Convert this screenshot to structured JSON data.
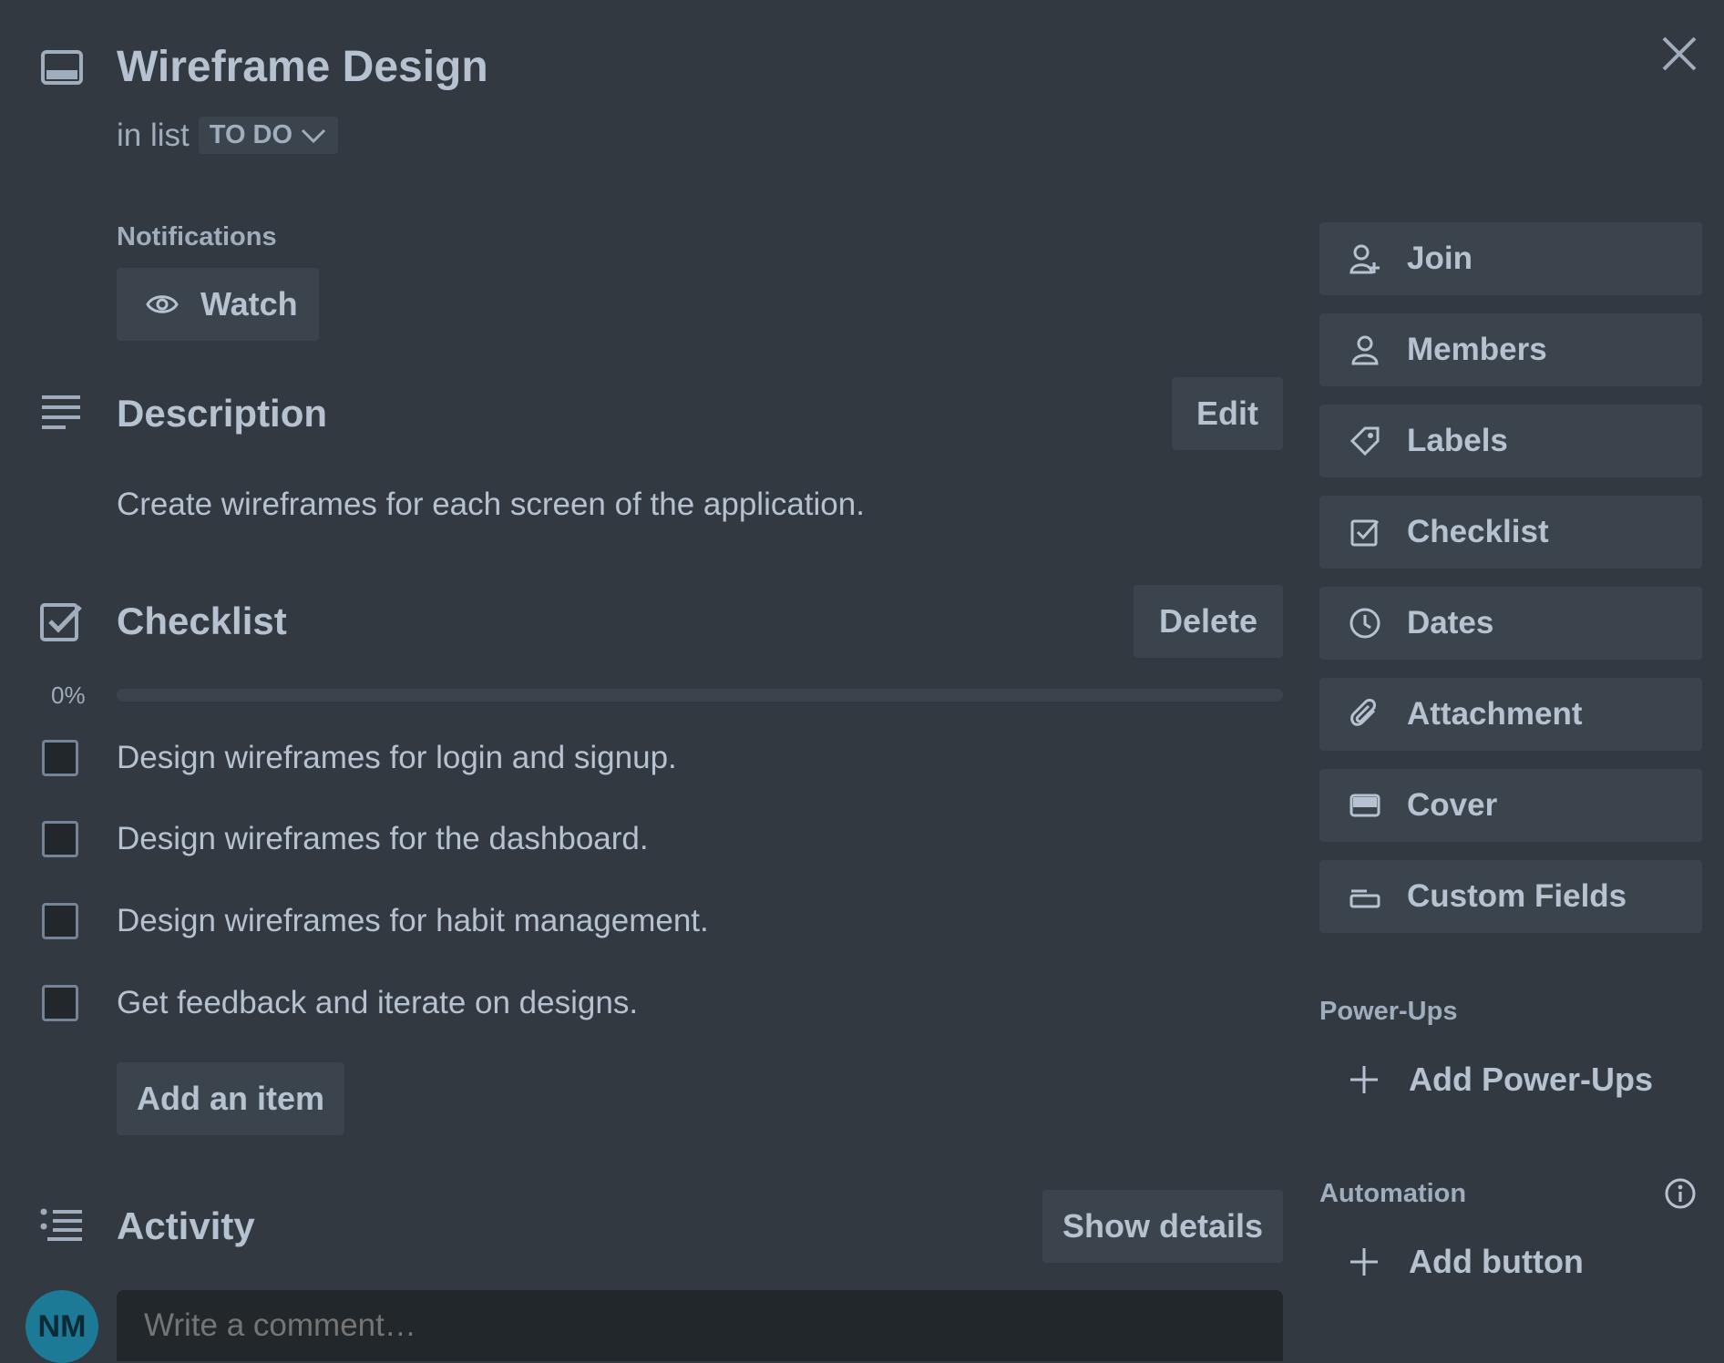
{
  "card": {
    "title": "Wireframe Design",
    "in_list_prefix": "in list",
    "list_name": "TO DO"
  },
  "notifications": {
    "label": "Notifications",
    "watch_label": "Watch"
  },
  "description": {
    "title": "Description",
    "edit_label": "Edit",
    "text": "Create wireframes for each screen of the application."
  },
  "checklist": {
    "title": "Checklist",
    "delete_label": "Delete",
    "progress_text": "0%",
    "progress_value": 0,
    "items": [
      {
        "text": "Design wireframes for login and signup.",
        "checked": false
      },
      {
        "text": "Design wireframes for the dashboard.",
        "checked": false
      },
      {
        "text": "Design wireframes for habit management.",
        "checked": false
      },
      {
        "text": "Get feedback and iterate on designs.",
        "checked": false
      }
    ],
    "add_item_label": "Add an item"
  },
  "activity": {
    "title": "Activity",
    "show_details_label": "Show details",
    "avatar_initials": "NM",
    "comment_placeholder": "Write a comment…"
  },
  "sidebar": {
    "buttons": [
      {
        "label": "Join",
        "icon": "user-add-icon"
      },
      {
        "label": "Members",
        "icon": "user-icon"
      },
      {
        "label": "Labels",
        "icon": "tag-icon"
      },
      {
        "label": "Checklist",
        "icon": "checklist-icon"
      },
      {
        "label": "Dates",
        "icon": "clock-icon"
      },
      {
        "label": "Attachment",
        "icon": "paperclip-icon"
      },
      {
        "label": "Cover",
        "icon": "cover-icon"
      },
      {
        "label": "Custom Fields",
        "icon": "custom-fields-icon"
      }
    ],
    "powerups_label": "Power-Ups",
    "add_powerups_label": "Add Power-Ups",
    "automation_label": "Automation",
    "add_button_label": "Add button"
  },
  "colors": {
    "background": "#323940",
    "button": "#3b444c",
    "text": "#b6c2cf",
    "avatar": "#1d7a96"
  }
}
